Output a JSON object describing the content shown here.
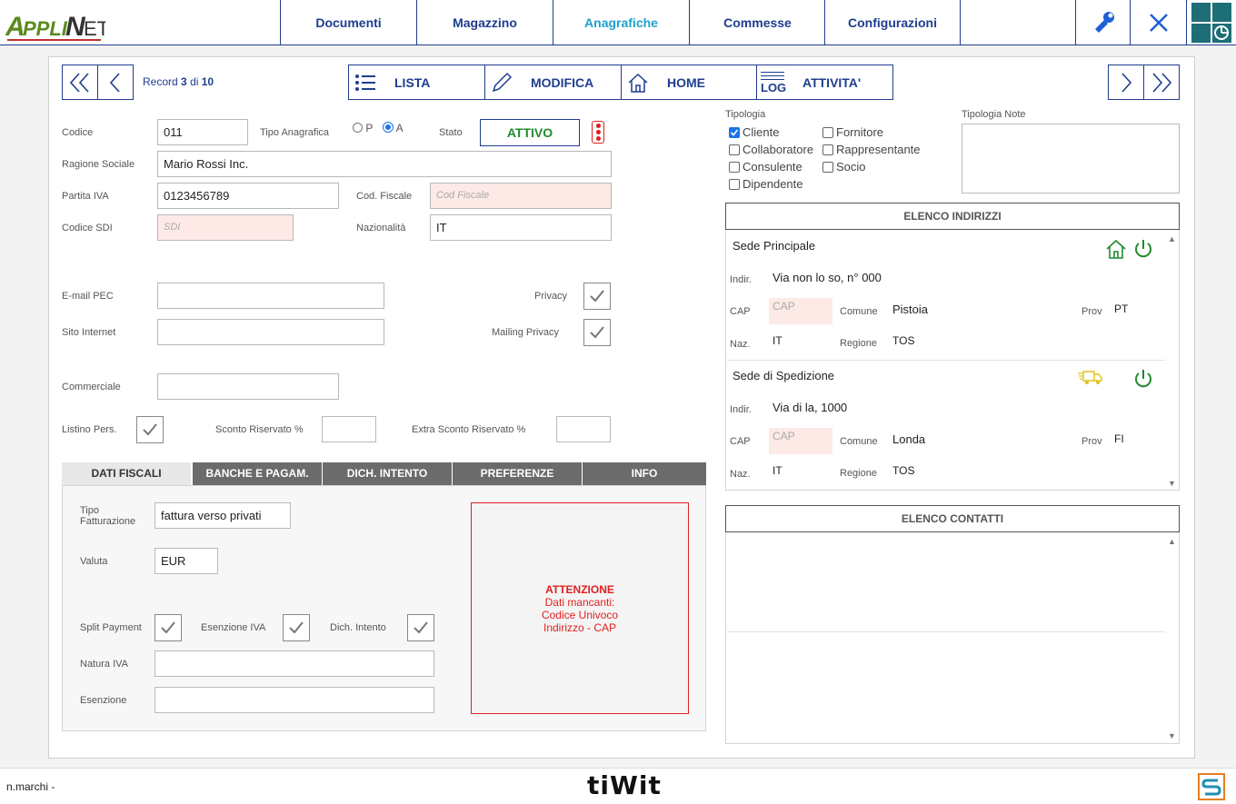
{
  "header": {
    "logo_text": "APPLINET",
    "nav": [
      "Documenti",
      "Magazzino",
      "Anagrafiche",
      "Commesse",
      "Configurazioni"
    ]
  },
  "toolbar": {
    "record_prefix": "Record",
    "record_current": "3",
    "record_of": "di",
    "record_total": "10",
    "lista": "LISTA",
    "modifica": "MODIFICA",
    "home": "HOME",
    "attivita": "ATTIVITA'",
    "log_label": "LOG"
  },
  "form": {
    "codice_label": "Codice",
    "codice": "011",
    "tipo_anagrafica_label": "Tipo Anagrafica",
    "tipo_p": "P",
    "tipo_a": "A",
    "stato_label": "Stato",
    "stato": "ATTIVO",
    "ragione_sociale_label": "Ragione Sociale",
    "ragione_sociale": "Mario Rossi Inc.",
    "partita_iva_label": "Partita IVA",
    "partita_iva": "0123456789",
    "cod_fiscale_label": "Cod. Fiscale",
    "cod_fiscale_placeholder": "Cod Fiscale",
    "codice_sdi_label": "Codice SDI",
    "sdi_placeholder": "SDI",
    "nazionalita_label": "Nazionalità",
    "nazionalita": "IT",
    "email_pec_label": "E-mail PEC",
    "privacy_label": "Privacy",
    "sito_label": "Sito Internet",
    "mailing_label": "Mailing Privacy",
    "commerciale_label": "Commerciale",
    "listino_label": "Listino Pers.",
    "sconto_label": "Sconto Riservato %",
    "extra_sconto_label": "Extra Sconto Riservato %"
  },
  "tipologia": {
    "label": "Tipologia",
    "note_label": "Tipologia Note",
    "items": [
      {
        "label": "Cliente",
        "checked": true
      },
      {
        "label": "Collaboratore",
        "checked": false
      },
      {
        "label": "Consulente",
        "checked": false
      },
      {
        "label": "Dipendente",
        "checked": false
      },
      {
        "label": "Fornitore",
        "checked": false
      },
      {
        "label": "Rappresentante",
        "checked": false
      },
      {
        "label": "Socio",
        "checked": false
      }
    ]
  },
  "tabs": [
    "DATI FISCALI",
    "BANCHE E PAGAM.",
    "DICH. INTENTO",
    "PREFERENZE",
    "INFO"
  ],
  "fiscal": {
    "tipo_fatt_label_1": "Tipo",
    "tipo_fatt_label_2": "Fatturazione",
    "tipo_fatt": "fattura verso privati",
    "valuta_label": "Valuta",
    "valuta": "EUR",
    "split_label": "Split Payment",
    "esenzione_iva_label": "Esenzione IVA",
    "dich_intento_label": "Dich. Intento",
    "natura_iva_label": "Natura IVA",
    "esenzione_label": "Esenzione"
  },
  "warning": {
    "title": "ATTENZIONE",
    "line1": "Dati mancanti:",
    "line2": "Codice Univoco",
    "line3": "Indirizzo - CAP",
    "color": "#e02020"
  },
  "indirizzi": {
    "header": "ELENCO INDIRIZZI",
    "items": [
      {
        "title": "Sede Principale",
        "indir_label": "Indir.",
        "indir": "Via non lo so, n° 000",
        "cap_label": "CAP",
        "cap_placeholder": "CAP",
        "comune_label": "Comune",
        "comune": "Pistoia",
        "prov_label": "Prov",
        "prov": "PT",
        "naz_label": "Naz.",
        "naz": "IT",
        "regione_label": "Regione",
        "regione": "TOS"
      },
      {
        "title": "Sede di Spedizione",
        "indir_label": "Indir.",
        "indir": "Via di la, 1000",
        "cap_label": "CAP",
        "cap_placeholder": "CAP",
        "comune_label": "Comune",
        "comune": "Londa",
        "prov_label": "Prov",
        "prov": "FI",
        "naz_label": "Naz.",
        "naz": "IT",
        "regione_label": "Regione",
        "regione": "TOS"
      }
    ]
  },
  "contatti": {
    "header": "ELENCO CONTATTI"
  },
  "status": {
    "user": "n.marchi -",
    "brand": "tiWit"
  },
  "colors": {
    "accent": "#1f3d8f",
    "active_tab": "#1fa0c9",
    "green": "#1f8a2e"
  }
}
